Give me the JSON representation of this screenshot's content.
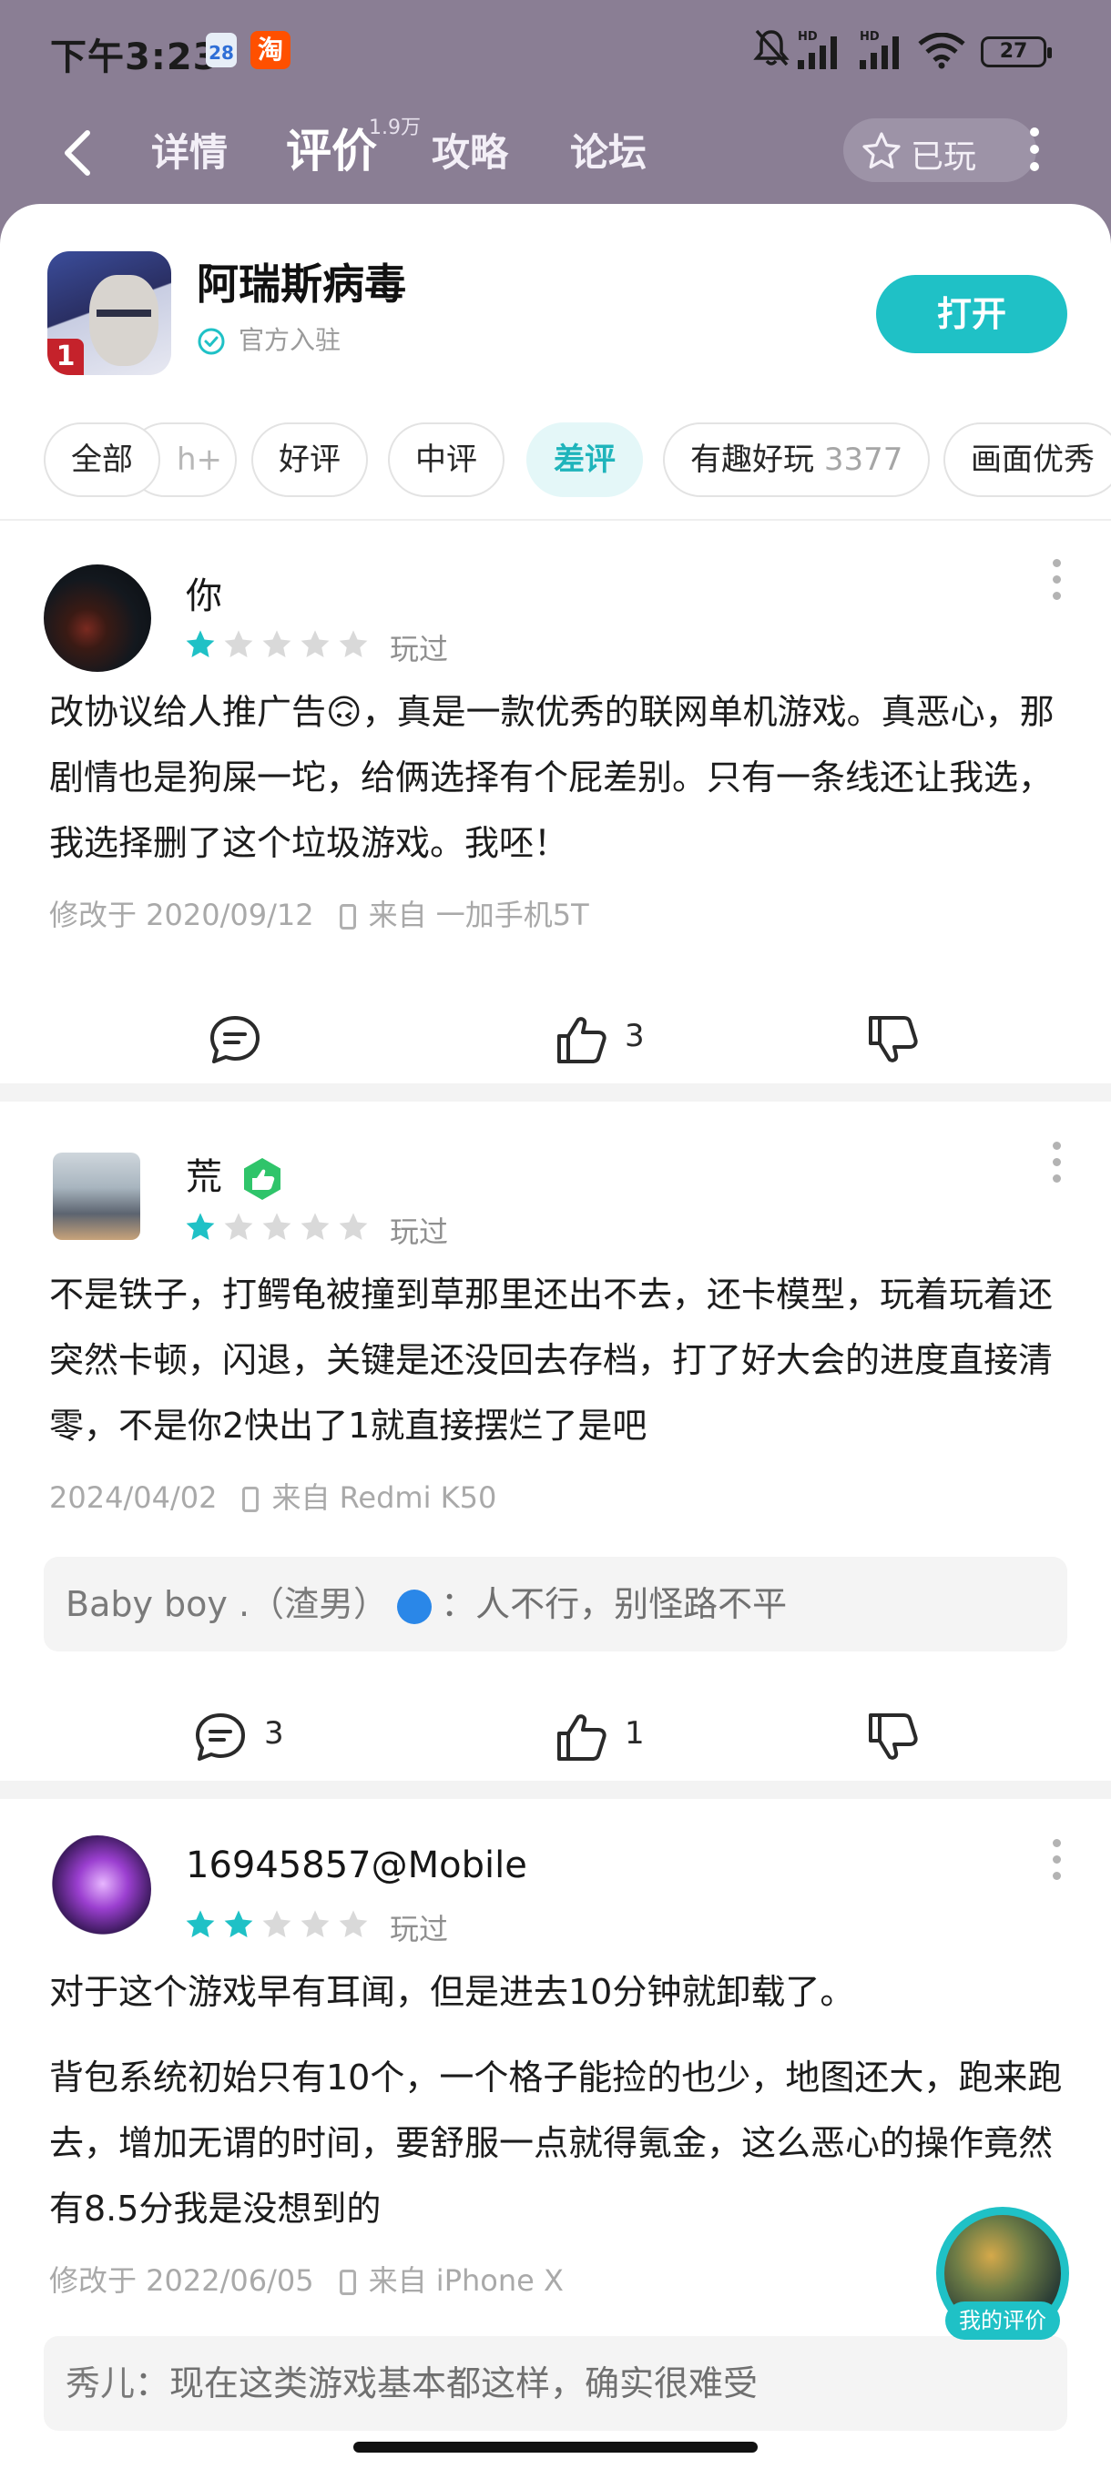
{
  "status_bar": {
    "time": "下午3:23",
    "calendar_day": "28",
    "taobao_glyph": "淘",
    "battery": "27",
    "network_hd_1": "HD",
    "network_hd_2": "HD"
  },
  "nav": {
    "tabs": [
      "详情",
      "评价",
      "攻略",
      "论坛"
    ],
    "active_tab": "评价",
    "review_count": "1.9万",
    "played_label": "已玩"
  },
  "app": {
    "name": "阿瑞斯病毒",
    "badge": "官方入驻",
    "icon_badge": "1",
    "open_label": "打开"
  },
  "filters": {
    "all": "全部",
    "partial": "h+",
    "good": "好评",
    "mid": "中评",
    "bad": "差评",
    "fun": "有趣好玩",
    "fun_count": "3377",
    "graphics": "画面优秀"
  },
  "reviews": [
    {
      "user": "你",
      "stars": 1,
      "tag": "玩过",
      "body": "改协议给人推广告🙃，真是一款优秀的联网单机游戏。真恶心，那剧情也是狗屎一坨，给俩选择有个屁差别。只有一条线还让我选，我选择删了这个垃圾游戏。我呸！",
      "date": "修改于 2020/09/12",
      "device": "来自 一加手机5T",
      "comments": "",
      "likes": "3"
    },
    {
      "user": "荒",
      "stars": 1,
      "tag": "玩过",
      "body": "不是铁子，打鳄龟被撞到草那里还出不去，还卡模型，玩着玩着还突然卡顿，闪退，关键是还没回去存档，打了好大会的进度直接清零，不是你2快出了1就直接摆烂了是吧",
      "date": "2024/04/02",
      "device": "来自 Redmi K50",
      "reply_user": "Baby boy .（渣男）",
      "reply_text": "：人不行，别怪路不平",
      "comments": "3",
      "likes": "1"
    },
    {
      "user": "16945857@Mobile",
      "stars": 2,
      "tag": "玩过",
      "body_p1": "对于这个游戏早有耳闻，但是进去10分钟就卸载了。",
      "body_p2": "背包系统初始只有10个，一个格子能捡的也少，地图还大，跑来跑去，增加无谓的时间，要舒服一点就得氪金，这么恶心的操作竟然有8.5分我是没想到的",
      "date": "修改于 2022/06/05",
      "device": "来自 iPhone X",
      "reply_user": "秀儿",
      "reply_text": "：现在这类游戏基本都这样，确实很难受"
    }
  ],
  "floating": {
    "label": "我的评价"
  },
  "colors": {
    "accent": "#1fc1c6",
    "header": "#8a7e94",
    "star_on": "#1fc1c6",
    "star_off": "#d9d9d9"
  }
}
